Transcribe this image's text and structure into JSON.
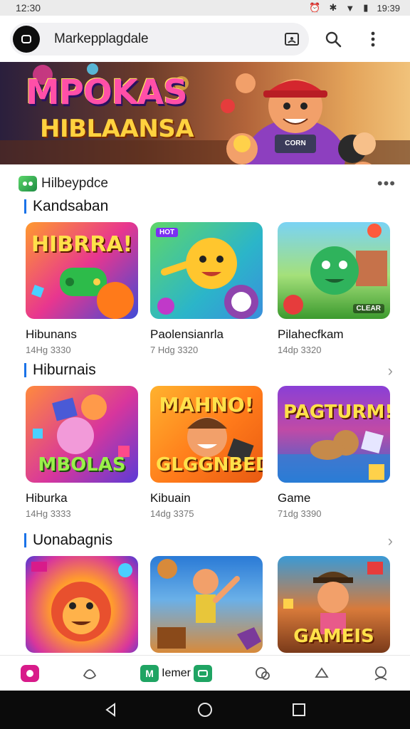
{
  "status_bar": {
    "time": "12:30",
    "right_text": "19:39"
  },
  "search": {
    "query": "Markepplagdale"
  },
  "banner": {
    "line1": "MPOKAS",
    "line2": "HIBLAANSA",
    "badge": "CORN"
  },
  "shop": {
    "name": "Hilbeypdce"
  },
  "sections": [
    {
      "title": "Kandsaban",
      "cards": [
        {
          "name": "Hibunans",
          "meta": "14Hg 3330",
          "art_text": "HIBRRA!"
        },
        {
          "name": "Paolensianrla",
          "meta": "7 Hdg 3320",
          "art_text": ""
        },
        {
          "name": "Pilahecfkam",
          "meta": "14dp 3320",
          "art_text": ""
        }
      ]
    },
    {
      "title": "Hiburnais",
      "cards": [
        {
          "name": "Hiburka",
          "meta": "14Hg 3333",
          "art_text": "MBOLAS"
        },
        {
          "name": "Kibuain",
          "meta": "14dg 3375",
          "art_text": "GLGGNBED"
        },
        {
          "name": "Game",
          "meta": "71dg 3390",
          "art_text": "PAGTURM!"
        }
      ]
    },
    {
      "title": "Uonabagnis",
      "cards": [
        {
          "art_text": ""
        },
        {
          "art_text": ""
        },
        {
          "art_text": "GAMEIS"
        }
      ]
    }
  ],
  "bottom_nav": {
    "center_label": "Iemer"
  },
  "colors": {
    "accent": "#1a73e8",
    "brand_green": "#1fa463",
    "brand_pink": "#d81b8a"
  }
}
